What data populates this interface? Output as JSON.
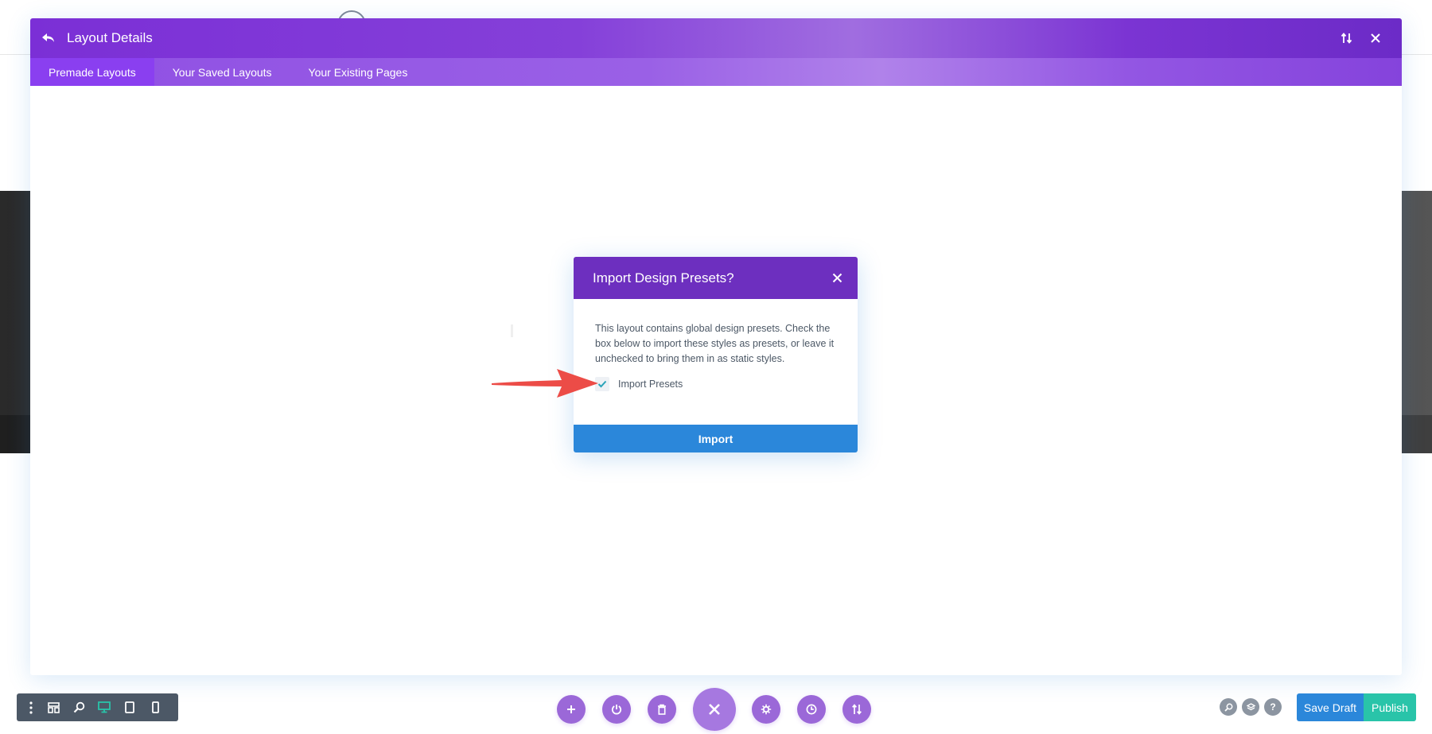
{
  "header": {
    "title": "Layout Details"
  },
  "tabs": [
    {
      "label": "Premade Layouts",
      "active": true
    },
    {
      "label": "Your Saved Layouts",
      "active": false
    },
    {
      "label": "Your Existing Pages",
      "active": false
    }
  ],
  "dialog": {
    "title": "Import Design Presets?",
    "text": "This layout contains global design presets. Check the box below to import these styles as presets, or leave it unchecked to bring them in as static styles.",
    "checkbox_label": "Import Presets",
    "checkbox_checked": true,
    "button_label": "Import"
  },
  "footer": {
    "left_icons": [
      "more-icon",
      "wireframe-icon",
      "zoom-icon",
      "desktop-icon",
      "tablet-icon",
      "phone-icon"
    ],
    "center_icons": [
      "add-icon",
      "power-icon",
      "trash-icon",
      "close-icon",
      "gear-icon",
      "history-icon",
      "sort-icon"
    ],
    "right_icons": [
      "search-icon",
      "layers-icon",
      "help-icon"
    ],
    "help_glyph": "?",
    "save_draft_label": "Save Draft",
    "publish_label": "Publish"
  },
  "colors": {
    "purple": "#7b2fd6",
    "dialog_header": "#6d2fbf",
    "blue": "#2b87da",
    "green": "#29c4a9",
    "arrow_red": "#ec4c47"
  }
}
